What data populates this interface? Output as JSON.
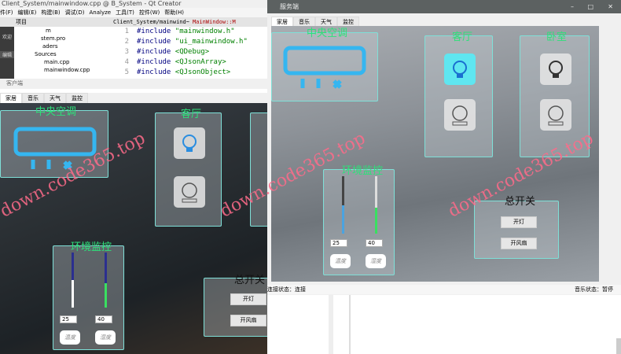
{
  "qt": {
    "title": "Client_System/mainwindow.cpp @ B_System - Qt Creator",
    "menu": [
      "件(F)",
      "编辑(E)",
      "构建(B)",
      "调试(D)",
      "Analyze",
      "工具(T)",
      "控件(W)",
      "帮助(H)"
    ],
    "project_label": "项目",
    "open_file": "Client_System/mainwind~",
    "func": "MainWindow::M",
    "sidebar": [
      "欢迎",
      "编辑"
    ],
    "tree": [
      "m",
      "stem.pro",
      "aders",
      "Sources",
      "main.cpp",
      "mainwindow.cpp"
    ],
    "code": [
      {
        "n": "1",
        "kw": "#include",
        "arg": "\"mainwindow.h\""
      },
      {
        "n": "2",
        "kw": "#include",
        "arg": "\"ui_mainwindow.h\""
      },
      {
        "n": "3",
        "kw": "#include",
        "arg": "<QDebug>"
      },
      {
        "n": "4",
        "kw": "#include",
        "arg": "<QJsonArray>"
      },
      {
        "n": "5",
        "kw": "#include",
        "arg": "<QJsonObject>"
      }
    ]
  },
  "client": {
    "title": "客户端",
    "tabs": [
      "家居",
      "音乐",
      "天气",
      "监控"
    ],
    "ac_title": "中央空调",
    "living_title": "客厅",
    "env_title": "环境监控",
    "switch_title": "总开关",
    "temp_value": "25",
    "humid_value": "40",
    "temp_btn": "温度",
    "humid_btn": "湿度",
    "light_btn": "开灯",
    "fan_btn": "开风扇",
    "temp_slider": 0.5,
    "humid_slider": 0.45
  },
  "server": {
    "title": "服务端",
    "tabs": [
      "家居",
      "音乐",
      "天气",
      "监控"
    ],
    "ac_title": "中央空调",
    "living_title": "客厅",
    "bedroom_title": "卧室",
    "env_title": "环境监控",
    "switch_title": "总开关",
    "temp_value": "25",
    "humid_value": "40",
    "temp_btn": "温度",
    "humid_btn": "湿度",
    "light_btn": "开灯",
    "fan_btn": "开风扇",
    "conn_status": "连接状态：连接",
    "music_status": "音乐状态：暂停",
    "temp_slider": 0.5,
    "humid_slider": 0.45
  },
  "watermark": "down.code365.top",
  "colors": {
    "accent": "#2ee07a",
    "panel_border": "#7fe0d8",
    "watermark": "#ff6b8a"
  }
}
